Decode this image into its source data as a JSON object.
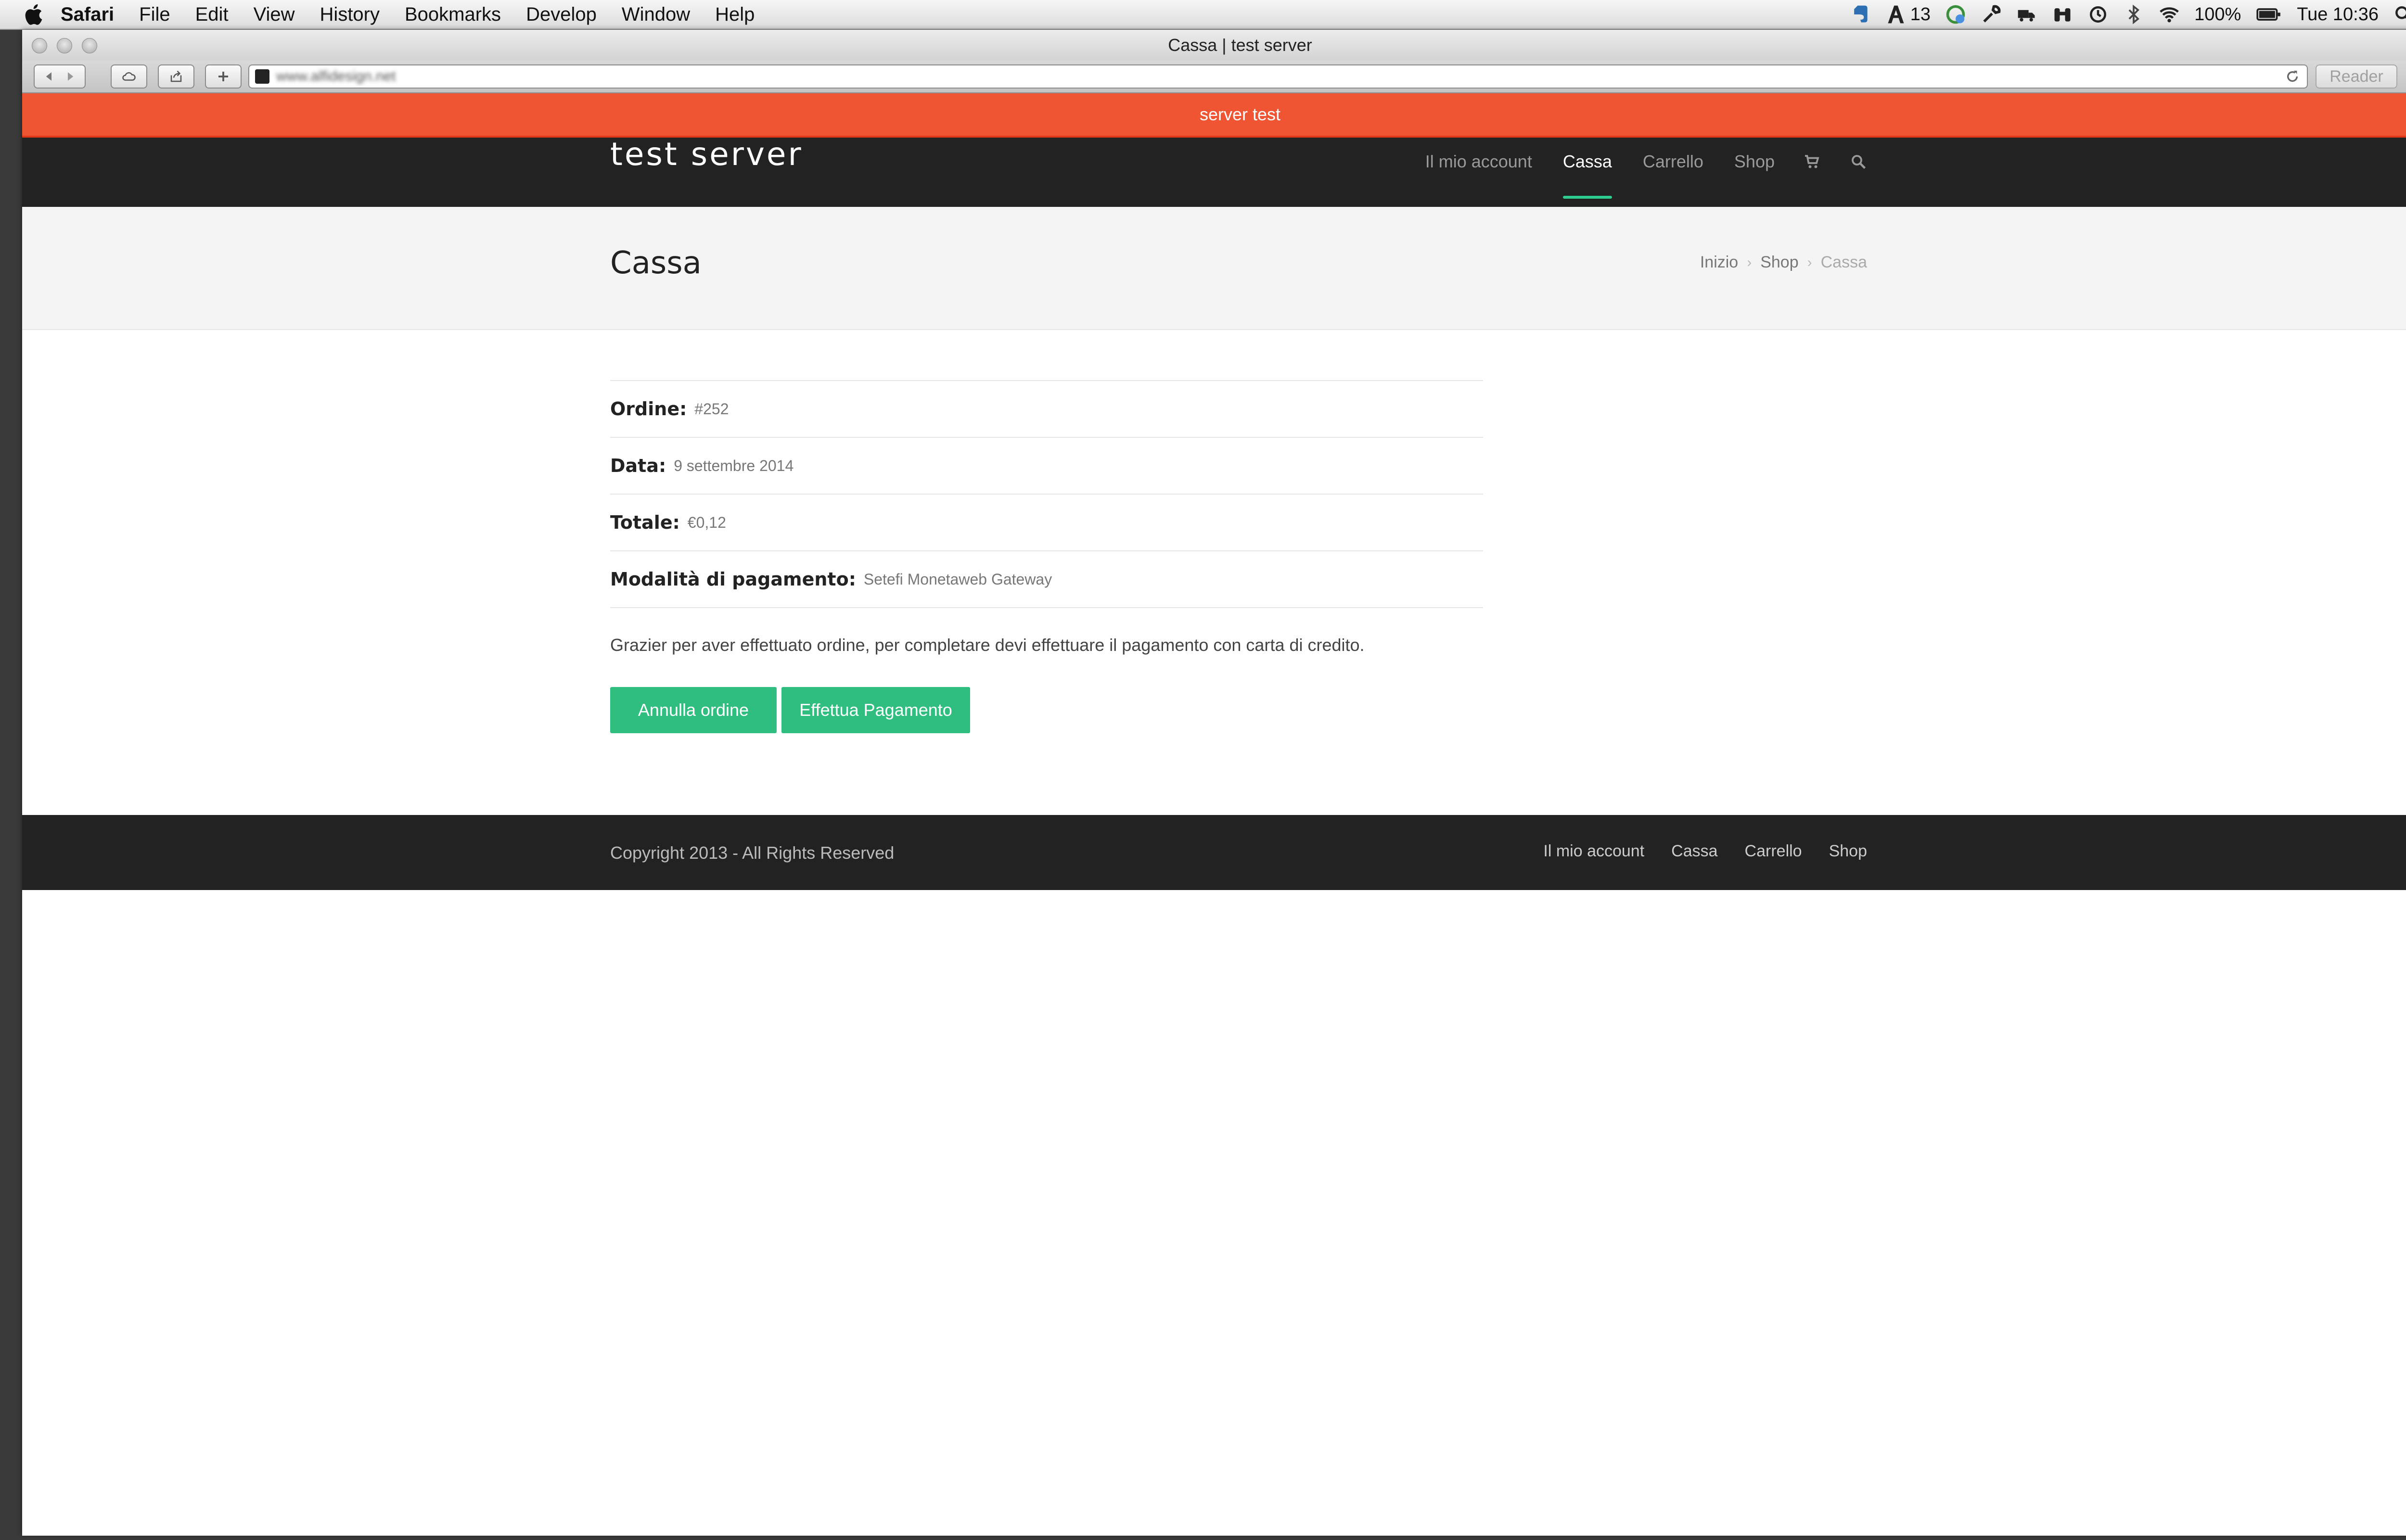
{
  "menubar": {
    "app_name": "Safari",
    "menus": [
      "File",
      "Edit",
      "View",
      "History",
      "Bookmarks",
      "Develop",
      "Window",
      "Help"
    ],
    "status": {
      "badge_count": "13",
      "battery_percent": "100%",
      "clock": "Tue 10:36"
    },
    "icons": [
      "apple-icon",
      "evernote-icon",
      "adobe-icon",
      "sync-icon",
      "wrench-icon",
      "truck-icon",
      "binoculars-icon",
      "time-machine-icon",
      "bluetooth-icon",
      "wifi-icon",
      "battery-icon",
      "spotlight-icon",
      "notification-center-icon"
    ]
  },
  "browser": {
    "window_title": "Cassa | test server",
    "address_domain": "www.alfidesign.net",
    "reader_label": "Reader"
  },
  "site": {
    "notice": "server test",
    "title": "test server",
    "nav": [
      {
        "label": "Il mio account",
        "active": false
      },
      {
        "label": "Cassa",
        "active": true
      },
      {
        "label": "Carrello",
        "active": false
      },
      {
        "label": "Shop",
        "active": false
      }
    ],
    "nav_icons": [
      "cart-icon",
      "search-icon"
    ],
    "accent_color": "#2fbd80",
    "notice_color": "#ef5532"
  },
  "page": {
    "title": "Cassa",
    "breadcrumb": [
      "Inizio",
      "Shop",
      "Cassa"
    ],
    "order": {
      "number_label": "Ordine:",
      "number_value": "#252",
      "date_label": "Data:",
      "date_value": "9 settembre 2014",
      "total_label": "Totale:",
      "total_value": "€0,12",
      "payment_label": "Modalità di pagamento:",
      "payment_value": "Setefi Monetaweb Gateway"
    },
    "message": "Grazier per aver effettuato ordine, per completare devi effettuare il pagamento con carta di credito.",
    "cancel_button": "Annulla ordine",
    "pay_button": "Effettua Pagamento"
  },
  "footer": {
    "copyright": "Copyright 2013 - All Rights Reserved",
    "links": [
      "Il mio account",
      "Cassa",
      "Carrello",
      "Shop"
    ]
  }
}
